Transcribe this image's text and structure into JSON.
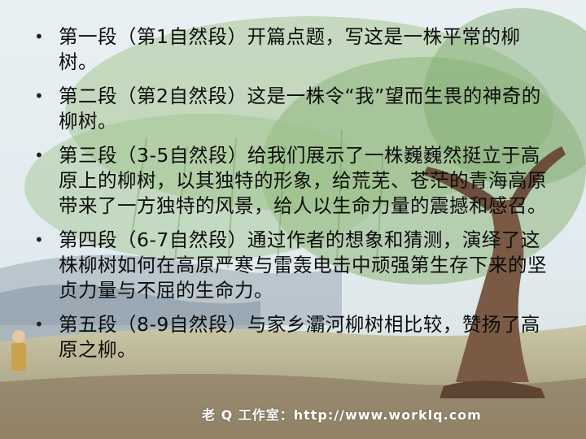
{
  "bullets": [
    {
      "text": "第一段（第1自然段）开篇点题，写这是一株平常的柳树。"
    },
    {
      "text": "第二段（第2自然段）这是一株令“我”望而生畏的神奇的柳树。"
    },
    {
      "text": "第三段（3-5自然段）给我们展示了一株巍巍然挺立于高原上的柳树，以其独特的形象，给荒芜、苍茫的青海高原带来了一方独特的风景，给人以生命力量的震撼和感召。"
    },
    {
      "text": "第四段（6-7自然段）通过作者的想象和猜测，演绎了这株柳树如何在高原严寒与雷轰电击中顽强第生存下来的坚贞力量与不屈的生命力。"
    },
    {
      "text": "第五段（8-9自然段）与家乡灞河柳树相比较，赞扬了高原之柳。"
    }
  ],
  "watermark": "老 Q 工作室：http://www.worklq.com",
  "bullet_char": "•",
  "colors": {
    "sky": "#dfeaf2",
    "text": "#0c0c0c",
    "willow": "#8fb77c",
    "trunk": "#7a5a45"
  }
}
